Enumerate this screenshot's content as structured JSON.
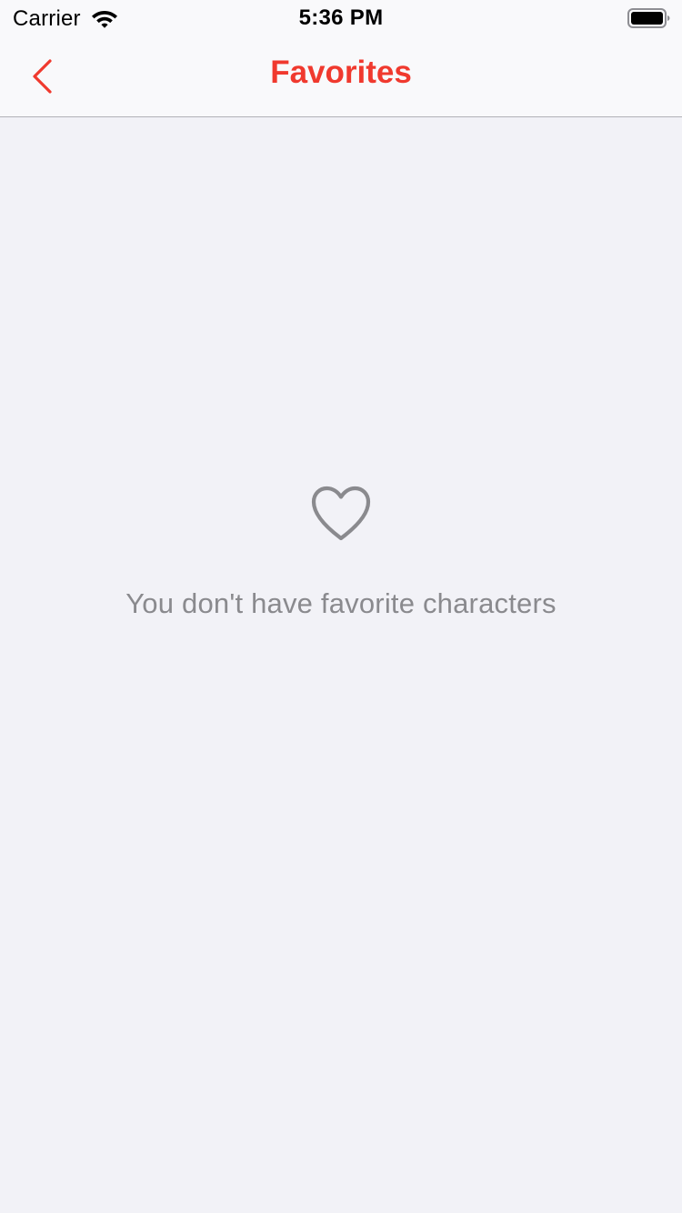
{
  "status_bar": {
    "carrier": "Carrier",
    "time": "5:36 PM",
    "wifi_icon": "wifi-icon",
    "battery_icon": "battery-icon"
  },
  "nav_bar": {
    "title": "Favorites",
    "back_icon": "chevron-left-icon",
    "accent_color": "#F0392E"
  },
  "empty_state": {
    "icon": "heart-outline-icon",
    "message": "You don't have favorite characters",
    "text_color": "#8A8A8E"
  },
  "colors": {
    "background": "#F2F2F7",
    "bar_background": "#F9F9FB"
  }
}
